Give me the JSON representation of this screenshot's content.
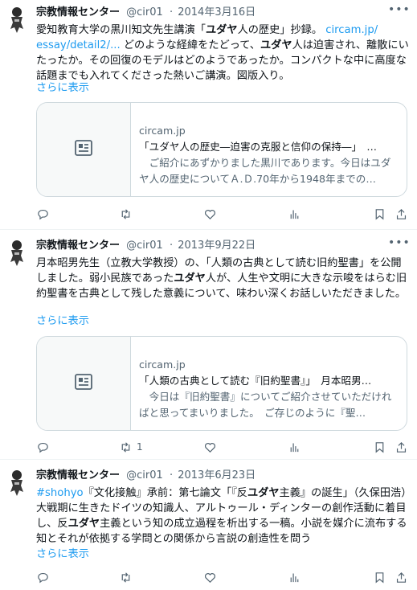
{
  "tweets": [
    {
      "author": "宗教情報センター",
      "handle": "@cir01",
      "date": "2014年3月16日",
      "text_a": "愛知教育大学の黒川知文先生講演「",
      "text_b": "ユダヤ",
      "text_c": "人の歴史」抄録。",
      "link_a": "circam.jp/",
      "link_b": "essay/detail2/...",
      "text_d": "どのような経緯をたどって、",
      "text_e": "ユダヤ",
      "text_f": "人は迫害され、離散にいたったか。その回復のモデルはどのようであったか。コンパクトな中に高度な話題までも入れてくださった熱いご講演。図版入り。",
      "show_more": "さらに表示",
      "card": {
        "domain": "circam.jp",
        "title": "「ユダヤ人の歴史―迫害の克服と信仰の保持―」　…",
        "desc": "　ご紹介にあずかりました黒川であります。今日はユダヤ人の歴史についてＡ.Ｄ.70年から1948年までの…"
      },
      "retweet_count": ""
    },
    {
      "author": "宗教情報センター",
      "handle": "@cir01",
      "date": "2013年9月22日",
      "text_a": "月本昭男先生（立教大学教授）の、「人類の古典として読む旧約聖書」を公開しました。弱小民族であった",
      "text_b": "ユダヤ",
      "text_c": "人が、人生や文明に大きな示唆をはらむ旧約聖書を古典として残した意義について、味わい深くお話しいただきました。",
      "show_more": "さらに表示",
      "card": {
        "domain": "circam.jp",
        "title": "「人類の古典として読む『旧約聖書』」　月本昭男…",
        "desc": "　今日は『旧約聖書』についてご紹介させていただければと思ってまいりました。　ご存じのように『聖…"
      },
      "retweet_count": "1"
    },
    {
      "author": "宗教情報センター",
      "handle": "@cir01",
      "date": "2013年6月23日",
      "hashtag": "#shohyo",
      "text_a": "『文化接触』承前：第七論文「『反",
      "text_b": "ユダヤ",
      "text_c": "主義』の誕生」（久保田浩）大戦期に生きたドイツの知識人、アルトゥール・ディンターの創作活動に着目し、反",
      "text_d": "ユダヤ",
      "text_e": "主義という知の成立過程を析出する一稿。小説を媒介に流布する知とそれが依拠する学問との関係から言説の創造性を問う",
      "show_more": "さらに表示",
      "retweet_count": ""
    }
  ],
  "icons": {
    "reply": "reply-icon",
    "retweet": "retweet-icon",
    "like": "like-icon",
    "views": "views-icon",
    "bookmark": "bookmark-icon",
    "share": "share-icon",
    "more": "more-icon",
    "card_placeholder": "article-icon"
  },
  "colors": {
    "link": "#1d9bf0",
    "text": "#0f1419",
    "secondary": "#536471",
    "border": "#cfd9de"
  }
}
